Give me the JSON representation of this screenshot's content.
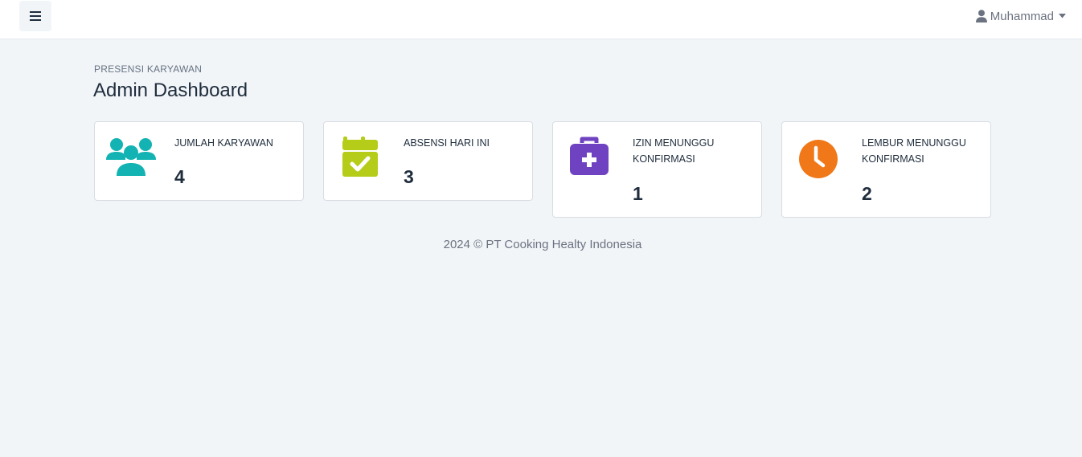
{
  "header": {
    "menu_icon": "hamburger-icon",
    "user_icon": "user-icon",
    "user_name": "Muhammad",
    "caret_icon": "caret-down-icon"
  },
  "page": {
    "pretitle": "PRESENSI KARYAWAN",
    "title": "Admin Dashboard"
  },
  "cards": [
    {
      "label": "JUMLAH KARYAWAN",
      "value": "4",
      "icon": "users-icon",
      "color": "#14b3b3"
    },
    {
      "label": "ABSENSI HARI INI",
      "value": "3",
      "icon": "calendar-check-icon",
      "color": "#b5cc18"
    },
    {
      "label": "IZIN MENUNGGU KONFIRMASI",
      "value": "1",
      "icon": "medical-kit-icon",
      "color": "#6f42c1"
    },
    {
      "label": "LEMBUR MENUNGGU KONFIRMASI",
      "value": "2",
      "icon": "clock-icon",
      "color": "#f07818"
    }
  ],
  "footer": {
    "text": "2024 © PT Cooking Healty Indonesia"
  }
}
